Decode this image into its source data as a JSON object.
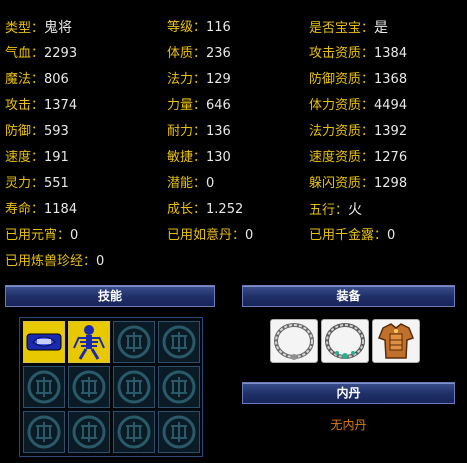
{
  "stats": {
    "row1": [
      {
        "label": "类型：",
        "value": "鬼将"
      },
      {
        "label": "等级：",
        "value": "116"
      },
      {
        "label": "是否宝宝：",
        "value": "是"
      }
    ],
    "row2": [
      {
        "label": "气血：",
        "value": "2293"
      },
      {
        "label": "体质：",
        "value": "236"
      },
      {
        "label": "攻击资质：",
        "value": "1384"
      }
    ],
    "row3": [
      {
        "label": "魔法：",
        "value": "806"
      },
      {
        "label": "法力：",
        "value": "129"
      },
      {
        "label": "防御资质：",
        "value": "1368"
      }
    ],
    "row4": [
      {
        "label": "攻击：",
        "value": "1374"
      },
      {
        "label": "力量：",
        "value": "646"
      },
      {
        "label": "体力资质：",
        "value": "4494"
      }
    ],
    "row5": [
      {
        "label": "防御：",
        "value": "593"
      },
      {
        "label": "耐力：",
        "value": "136"
      },
      {
        "label": "法力资质：",
        "value": "1392"
      }
    ],
    "row6": [
      {
        "label": "速度：",
        "value": "191"
      },
      {
        "label": "敏捷：",
        "value": "130"
      },
      {
        "label": "速度资质：",
        "value": "1276"
      }
    ],
    "row7": [
      {
        "label": "灵力：",
        "value": "551"
      },
      {
        "label": "潜能：",
        "value": "0"
      },
      {
        "label": "躲闪资质：",
        "value": "1298"
      }
    ],
    "row8": [
      {
        "label": "寿命：",
        "value": "1184"
      },
      {
        "label": "成长：",
        "value": "1.252"
      },
      {
        "label": "五行：",
        "value": "火"
      }
    ],
    "row9": [
      {
        "label": "已用元宵：",
        "value": "0"
      },
      {
        "label": "已用如意丹：",
        "value": "0"
      },
      {
        "label": "已用千金露：",
        "value": "0"
      }
    ],
    "row10": [
      {
        "label": "已用炼兽珍经：",
        "value": "0"
      }
    ]
  },
  "sections": {
    "skills_title": "技能",
    "equipment_title": "装备",
    "neidan_title": "内丹",
    "neidan_empty": "无内丹"
  },
  "skills": [
    {
      "icon": "skill-mouth-icon",
      "filled": true
    },
    {
      "icon": "skill-skeleton-icon",
      "filled": true
    },
    {
      "icon": "empty-slot-icon",
      "filled": false
    },
    {
      "icon": "empty-slot-icon",
      "filled": false
    },
    {
      "icon": "empty-slot-icon",
      "filled": false
    },
    {
      "icon": "empty-slot-icon",
      "filled": false
    },
    {
      "icon": "empty-slot-icon",
      "filled": false
    },
    {
      "icon": "empty-slot-icon",
      "filled": false
    },
    {
      "icon": "empty-slot-icon",
      "filled": false
    },
    {
      "icon": "empty-slot-icon",
      "filled": false
    },
    {
      "icon": "empty-slot-icon",
      "filled": false
    },
    {
      "icon": "empty-slot-icon",
      "filled": false
    }
  ],
  "equipment": [
    {
      "icon": "silver-ring-icon"
    },
    {
      "icon": "jade-necklace-icon"
    },
    {
      "icon": "armor-icon"
    }
  ],
  "colors": {
    "label": "#e8c010",
    "value": "#e8e8e8",
    "header_bg": "#1f2f66",
    "slot_filled": "#e8c800",
    "neidan_text": "#e07a10"
  }
}
